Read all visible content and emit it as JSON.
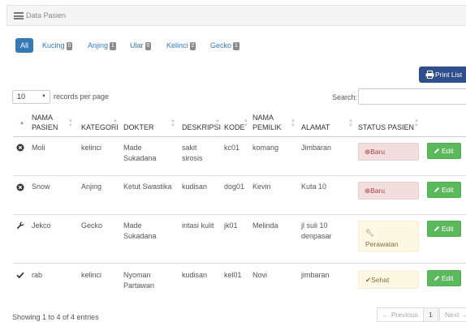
{
  "panel": {
    "title": "Data Pasien",
    "icon": "hamburger-icon"
  },
  "tabs": [
    {
      "label": "All"
    },
    {
      "label": "Kucing",
      "count": "0"
    },
    {
      "label": "Anjing",
      "count": "1"
    },
    {
      "label": "Ular",
      "count": "0"
    },
    {
      "label": "Kelinci",
      "count": "2"
    },
    {
      "label": "Gecko",
      "count": "1"
    }
  ],
  "toolbar": {
    "print_label": "Print List",
    "print_icon": "printer-icon"
  },
  "table_controls": {
    "length_value": "10",
    "length_label": "records per page",
    "search_label": "Search:",
    "search_value": ""
  },
  "columns": {
    "nama_pasien": [
      "NAMA",
      "PASIEN"
    ],
    "kategori": "KATEGORI",
    "dokter": "DOKTER",
    "deskripsi": "DESKRIPSI",
    "kode": "KODE",
    "nama_pemilik": [
      "NAMA",
      "PEMILIK"
    ],
    "alamat": "ALAMAT",
    "status": "STATUS PASIEN"
  },
  "rows": [
    {
      "icon": "circle-x-icon",
      "nama": "Moli",
      "kategori": "kelinci",
      "dokter": [
        "Made",
        "Sukadana"
      ],
      "deskripsi": [
        "sakit",
        "sirosis"
      ],
      "kode": "kc01",
      "pemilik": "komang",
      "alamat": [
        "Jimbaran"
      ],
      "status": "Baru",
      "status_type": "baru",
      "edit": "Edit"
    },
    {
      "icon": "circle-x-icon",
      "nama": "Snow",
      "kategori": "Anjing",
      "dokter": [
        "Ketut Swastika"
      ],
      "deskripsi": [
        "kudisan"
      ],
      "kode": "dog01",
      "pemilik": "Kevin",
      "alamat": [
        "Kuta 10"
      ],
      "status": "Baru",
      "status_type": "baru",
      "edit": "Edit"
    },
    {
      "icon": "wrench-icon",
      "nama": "Jekco",
      "kategori": "Gecko",
      "dokter": [
        "Made",
        "Sukadana"
      ],
      "deskripsi": [
        "iritasi kulit"
      ],
      "kode": "jk01",
      "pemilik": "Melinda",
      "alamat": [
        "jl suli 10",
        "denpasar"
      ],
      "status": "Perawatan",
      "status_type": "perawatan",
      "edit": "Edit"
    },
    {
      "icon": "check-icon",
      "nama": "rab",
      "kategori": "kelinci",
      "dokter": [
        "Nyoman",
        "Partawan"
      ],
      "deskripsi": [
        "kudisan"
      ],
      "kode": "kel01",
      "pemilik": "Novi",
      "alamat": [
        "jimbaran"
      ],
      "status": "Sehat",
      "status_type": "sehat",
      "edit": "Edit"
    }
  ],
  "footer": {
    "info": "Showing 1 to 4 of 4 entries",
    "prev": "← Previous",
    "page": "1",
    "next": "Next →"
  }
}
